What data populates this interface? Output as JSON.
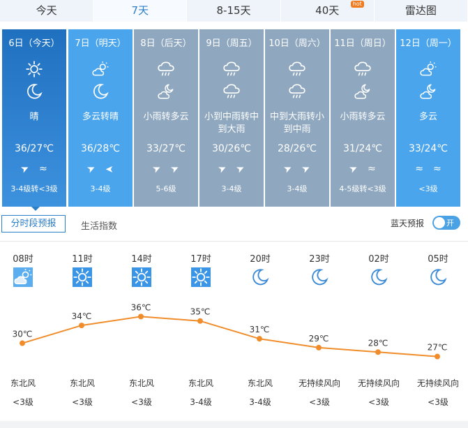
{
  "tabs": [
    {
      "label": "今天"
    },
    {
      "label": "7天",
      "active": true
    },
    {
      "label": "8-15天"
    },
    {
      "label": "40天",
      "badge": "hot"
    },
    {
      "label": "雷达图"
    }
  ],
  "days": [
    {
      "date": "6日（今天）",
      "icon_day": "sunny-icon",
      "icon_night": "moon-icon",
      "desc": "晴",
      "temp": "36/27℃",
      "wind": [
        "➤",
        "≈"
      ],
      "level": "3-4级转<3级",
      "bg": "#2b7ec8"
    },
    {
      "date": "7日（明天）",
      "icon_day": "partly-cloudy-icon",
      "icon_night": "moon-icon",
      "desc": "多云转晴",
      "temp": "36/28℃",
      "wind": [
        "➤",
        "➤"
      ],
      "level": "3-4级",
      "bg": "#4aa5ec"
    },
    {
      "date": "8日（后天）",
      "icon_day": "rain-icon",
      "icon_night": "cloudy-night-icon",
      "desc": "小雨转多云",
      "temp": "33/27℃",
      "wind": [
        "➤",
        "➤"
      ],
      "level": "5-6级",
      "bg": "#8fa8bf"
    },
    {
      "date": "9日（周五）",
      "icon_day": "rain-icon",
      "icon_night": "rain-icon",
      "desc": "小到中雨转中到大雨",
      "temp": "30/26℃",
      "wind": [
        "➤",
        "➤"
      ],
      "level": "3-4级",
      "bg": "#8fa8bf"
    },
    {
      "date": "10日（周六）",
      "icon_day": "rain-icon",
      "icon_night": "rain-icon",
      "desc": "中到大雨转小到中雨",
      "temp": "28/26℃",
      "wind": [
        "➤",
        "➤"
      ],
      "level": "3-4级",
      "bg": "#8fa8bf"
    },
    {
      "date": "11日（周日）",
      "icon_day": "rain-icon",
      "icon_night": "cloudy-night-icon",
      "desc": "小雨转多云",
      "temp": "31/24℃",
      "wind": [
        "➤",
        "≈"
      ],
      "level": "4-5级转<3级",
      "bg": "#8fa8bf"
    },
    {
      "date": "12日（周一）",
      "icon_day": "partly-cloudy-icon",
      "icon_night": "cloudy-night-icon",
      "desc": "多云",
      "temp": "33/24℃",
      "wind": [
        "≈",
        "≈"
      ],
      "level": "<3级",
      "bg": "#4aa5ec"
    }
  ],
  "subtabs": {
    "active": "分时段预报",
    "other": "生活指数"
  },
  "lantian": {
    "label": "蓝天预报",
    "toggle": "开"
  },
  "hourly": [
    {
      "time": "08时",
      "icon": "partly-cloudy-icon",
      "temp": "30℃",
      "dir": "东北风",
      "level": "<3级"
    },
    {
      "time": "11时",
      "icon": "sunny-icon",
      "temp": "34℃",
      "dir": "东北风",
      "level": "<3级"
    },
    {
      "time": "14时",
      "icon": "sunny-icon",
      "temp": "36℃",
      "dir": "东北风",
      "level": "<3级"
    },
    {
      "time": "17时",
      "icon": "sunny-icon",
      "temp": "35℃",
      "dir": "东北风",
      "level": "3-4级"
    },
    {
      "time": "20时",
      "icon": "moon-icon",
      "temp": "31℃",
      "dir": "东北风",
      "level": "3-4级"
    },
    {
      "time": "23时",
      "icon": "moon-icon",
      "temp": "29℃",
      "dir": "无持续风向",
      "level": "<3级"
    },
    {
      "time": "02时",
      "icon": "moon-icon",
      "temp": "28℃",
      "dir": "无持续风向",
      "level": "<3级"
    },
    {
      "time": "05时",
      "icon": "moon-icon",
      "temp": "27℃",
      "dir": "无持续风向",
      "level": "<3级"
    }
  ],
  "chart_data": {
    "type": "line",
    "categories": [
      "08时",
      "11时",
      "14时",
      "17时",
      "20时",
      "23时",
      "02时",
      "05时"
    ],
    "series": [
      {
        "values": [
          30,
          34,
          36,
          35,
          31,
          29,
          28,
          27
        ]
      }
    ],
    "data_labels": [
      "30℃",
      "34℃",
      "36℃",
      "35℃",
      "31℃",
      "29℃",
      "28℃",
      "27℃"
    ],
    "color": "#f08c2a"
  },
  "colors": {
    "accent": "#2b7ec8",
    "line": "#f08c2a"
  }
}
